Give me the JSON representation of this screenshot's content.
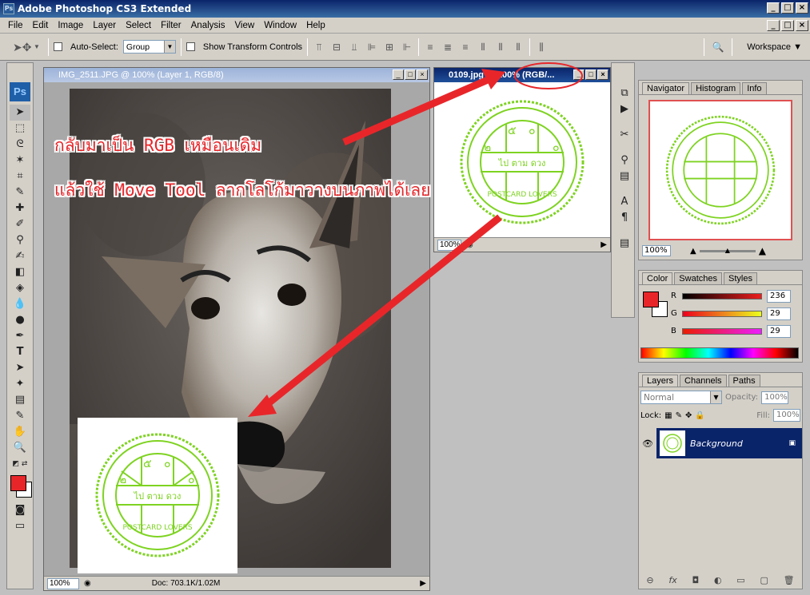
{
  "app": {
    "title": "Adobe Photoshop CS3 Extended",
    "icon": "Ps"
  },
  "menu": [
    "File",
    "Edit",
    "Image",
    "Layer",
    "Select",
    "Filter",
    "Analysis",
    "View",
    "Window",
    "Help"
  ],
  "options": {
    "auto_select_label": "Auto-Select:",
    "auto_select_value": "Group",
    "transform_label": "Show Transform Controls",
    "workspace_label": "Workspace"
  },
  "toolbox": {
    "badge": "Ps",
    "foreground_color": "#e8262a"
  },
  "doc1": {
    "title": "IMG_2511.JPG @ 100% (Layer 1, RGB/8)",
    "zoom": "100%",
    "doc_info": "Doc: 703.1K/1.02M"
  },
  "doc2": {
    "title": "0109.jpg @ 100% (RGB/...",
    "zoom": "100%"
  },
  "stamp": {
    "top_left": "๕",
    "top_right": "๐",
    "left": "๒",
    "right": "๐",
    "center": "ไป ตาม ดวง",
    "arc": "POSTCARD LOVERS",
    "color": "#7ed321"
  },
  "navigator": {
    "tabs": [
      "Navigator",
      "Histogram",
      "Info"
    ],
    "zoom": "100%"
  },
  "color_panel": {
    "tabs": [
      "Color",
      "Swatches",
      "Styles"
    ],
    "r_label": "R",
    "g_label": "G",
    "b_label": "B",
    "r": "236",
    "g": "29",
    "b": "29"
  },
  "layers": {
    "tabs": [
      "Layers",
      "Channels",
      "Paths"
    ],
    "blend_mode": "Normal",
    "opacity_label": "Opacity:",
    "opacity": "100%",
    "lock_label": "Lock:",
    "fill_label": "Fill:",
    "fill": "100%",
    "layer_name": "Background"
  },
  "annotation": {
    "line1": "กลับมาเป็น RGB เหมือนเดิม",
    "line2": "แล้วใช้ Move Tool ลากโลโก้มาวางบนภาพได้เลย",
    "color": "#e8262a"
  }
}
